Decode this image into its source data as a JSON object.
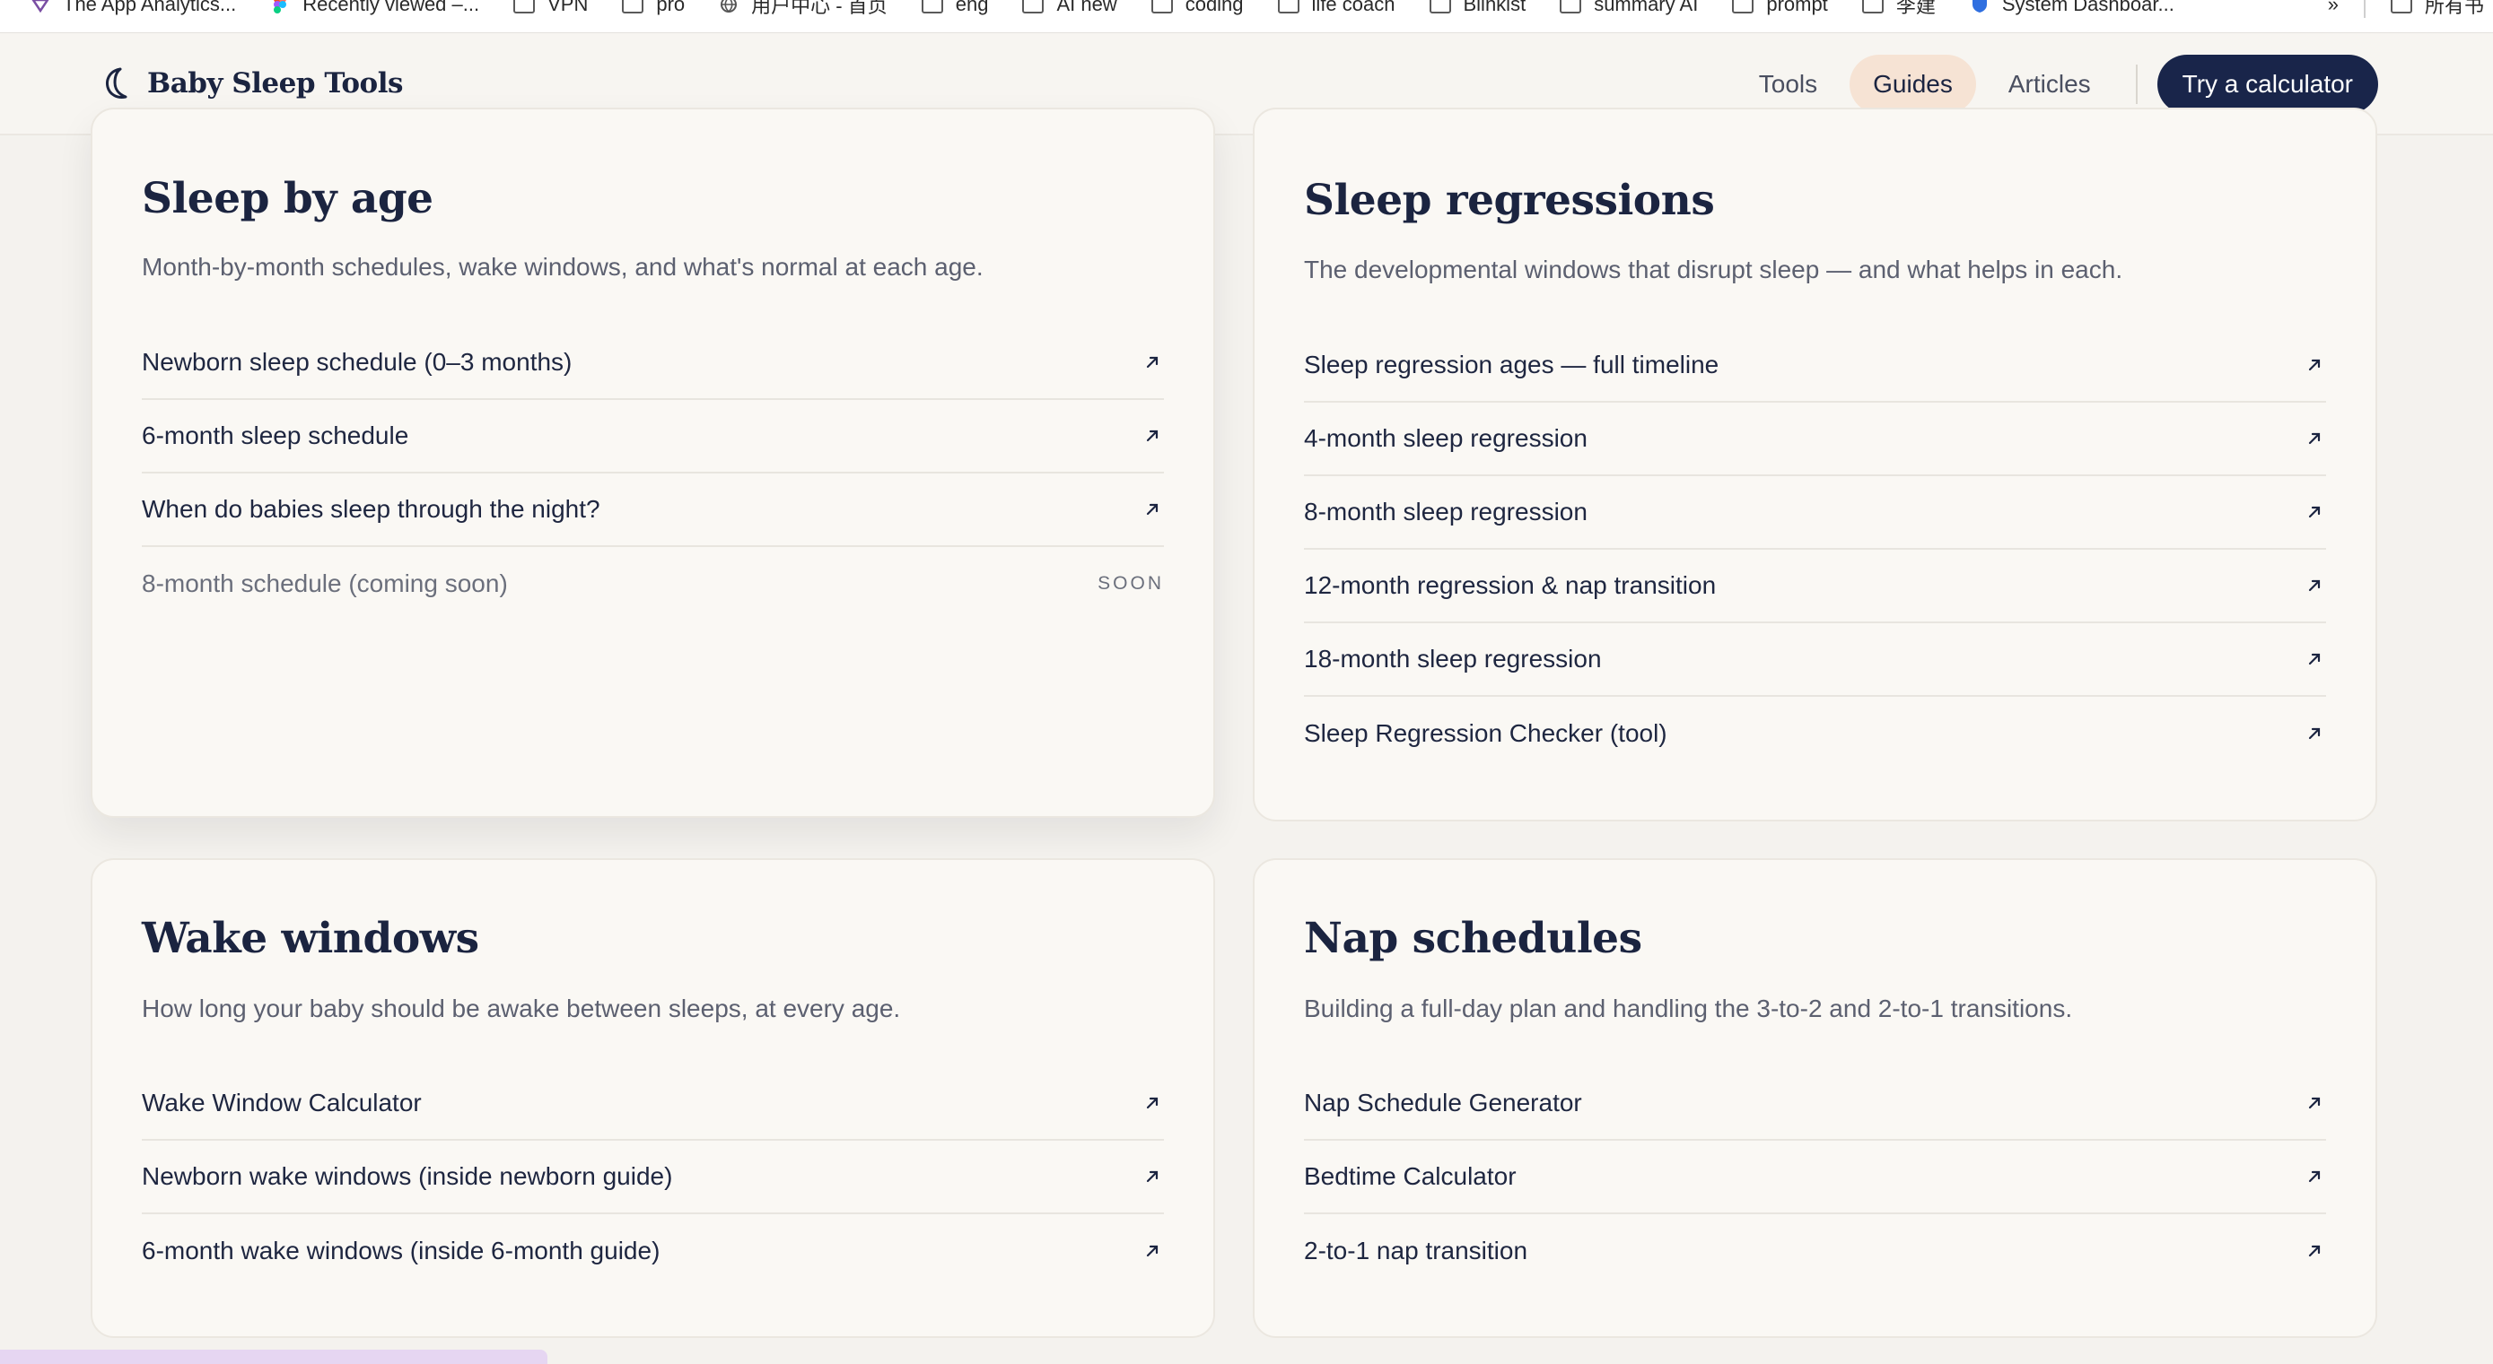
{
  "bookmarks": {
    "items": [
      {
        "label": "The App Analytics...",
        "icon": "analytics-icon"
      },
      {
        "label": "Recently viewed –...",
        "icon": "figma-icon"
      },
      {
        "label": "VPN",
        "icon": "folder-icon"
      },
      {
        "label": "pro",
        "icon": "folder-icon"
      },
      {
        "label": "用户中心 - 首页",
        "icon": "globe-icon"
      },
      {
        "label": "eng",
        "icon": "folder-icon"
      },
      {
        "label": "AI new",
        "icon": "folder-icon"
      },
      {
        "label": "coding",
        "icon": "folder-icon"
      },
      {
        "label": "life coach",
        "icon": "folder-icon"
      },
      {
        "label": "Blinkist",
        "icon": "folder-icon"
      },
      {
        "label": "summary AI",
        "icon": "folder-icon"
      },
      {
        "label": "prompt",
        "icon": "folder-icon"
      },
      {
        "label": "李建",
        "icon": "folder-icon"
      },
      {
        "label": "System Dashboar...",
        "icon": "shield-icon"
      }
    ],
    "overflow": "»",
    "all_bookmarks": "所有书"
  },
  "header": {
    "brand": "Baby Sleep Tools",
    "nav": [
      {
        "label": "Tools",
        "active": false
      },
      {
        "label": "Guides",
        "active": true
      },
      {
        "label": "Articles",
        "active": false
      }
    ],
    "cta": "Try a calculator"
  },
  "cards": [
    {
      "title": "Sleep by age",
      "description": "Month-by-month schedules, wake windows, and what's normal at each age.",
      "links": [
        {
          "label": "Newborn sleep schedule (0–3 months)"
        },
        {
          "label": "6-month sleep schedule"
        },
        {
          "label": "When do babies sleep through the night?"
        },
        {
          "label": "8-month schedule (coming soon)",
          "badge": "SOON"
        }
      ]
    },
    {
      "title": "Sleep regressions",
      "description": "The developmental windows that disrupt sleep — and what helps in each.",
      "links": [
        {
          "label": "Sleep regression ages — full timeline"
        },
        {
          "label": "4-month sleep regression"
        },
        {
          "label": "8-month sleep regression"
        },
        {
          "label": "12-month regression & nap transition"
        },
        {
          "label": "18-month sleep regression"
        },
        {
          "label": "Sleep Regression Checker (tool)"
        }
      ]
    },
    {
      "title": "Wake windows",
      "description": "How long your baby should be awake between sleeps, at every age.",
      "links": [
        {
          "label": "Wake Window Calculator"
        },
        {
          "label": "Newborn wake windows (inside newborn guide)"
        },
        {
          "label": "6-month wake windows (inside 6-month guide)"
        }
      ]
    },
    {
      "title": "Nap schedules",
      "description": "Building a full-day plan and handling the 3-to-2 and 2-to-1 transitions.",
      "links": [
        {
          "label": "Nap Schedule Generator"
        },
        {
          "label": "Bedtime Calculator"
        },
        {
          "label": "2-to-1 nap transition"
        }
      ]
    }
  ],
  "colors": {
    "navy": "#19254a",
    "active_pill": "#f6e3d4",
    "page_bg": "#f4f2ee",
    "card_bg": "#faf8f4"
  }
}
